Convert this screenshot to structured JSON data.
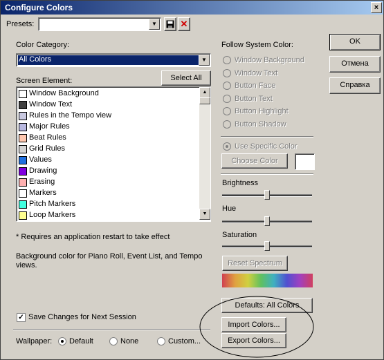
{
  "window": {
    "title": "Configure Colors",
    "close": "×"
  },
  "presets": {
    "label": "Presets:",
    "value": ""
  },
  "color_category": {
    "label": "Color Category:",
    "selected": "All Colors"
  },
  "screen_element": {
    "label": "Screen Element:",
    "select_all": "Select All"
  },
  "elements": [
    {
      "label": "Window Background",
      "color": "#ffffff"
    },
    {
      "label": "Window Text",
      "color": "#404040"
    },
    {
      "label": "Rules in the Tempo view",
      "color": "#c8c8e0"
    },
    {
      "label": "Major Rules",
      "color": "#b8b8e0"
    },
    {
      "label": "Beat Rules",
      "color": "#ffc8b0"
    },
    {
      "label": "Grid Rules",
      "color": "#d4d4d4"
    },
    {
      "label": "Values",
      "color": "#2070e0"
    },
    {
      "label": "Drawing",
      "color": "#8000e0"
    },
    {
      "label": "Erasing",
      "color": "#ffb0b0"
    },
    {
      "label": "Markers",
      "color": "#ffffff"
    },
    {
      "label": "Pitch Markers",
      "color": "#40ffe0"
    },
    {
      "label": "Loop Markers",
      "color": "#ffff90"
    }
  ],
  "note": "* Requires an application restart to take effect",
  "description": "Background color for Piano Roll, Event List, and Tempo views.",
  "save_changes": {
    "label": "Save Changes for Next Session",
    "checked": true
  },
  "wallpaper": {
    "label": "Wallpaper:",
    "options": [
      "Default",
      "None",
      "Custom..."
    ],
    "selected": "Default"
  },
  "follow_system": {
    "label": "Follow System Color:",
    "options": [
      "Window Background",
      "Window Text",
      "Button Face",
      "Button Text",
      "Button Highlight",
      "Button Shadow"
    ]
  },
  "use_specific": "Use Specific Color",
  "choose_color": "Choose Color",
  "brightness": {
    "label": "Brightness",
    "level": 0.5
  },
  "hue": {
    "label": "Hue",
    "level": 0.5
  },
  "saturation": {
    "label": "Saturation",
    "level": 0.5
  },
  "reset_spectrum": "Reset Spectrum",
  "defaults_button": "Defaults: All Colors",
  "import_button": "Import Colors...",
  "export_button": "Export Colors...",
  "side_buttons": {
    "ok": "OK",
    "cancel": "Отмена",
    "help": "Справка"
  }
}
